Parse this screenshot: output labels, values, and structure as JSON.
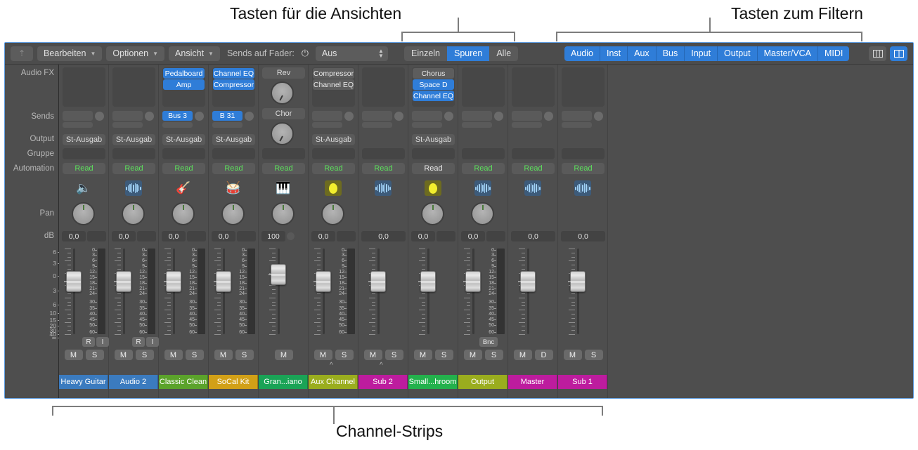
{
  "annotations": {
    "views": "Tasten für die Ansichten",
    "filter": "Tasten zum Filtern",
    "strips": "Channel-Strips"
  },
  "toolbar": {
    "back_icon": "up-arrow-icon",
    "menus": [
      {
        "label": "Bearbeiten",
        "chevron": "⌄"
      },
      {
        "label": "Optionen",
        "chevron": "⌄"
      },
      {
        "label": "Ansicht",
        "chevron": "⌄"
      }
    ],
    "sends_label": "Sends auf Fader:",
    "power_icon": "power-icon",
    "sends_value": "Aus",
    "view_segments": [
      {
        "label": "Einzeln",
        "active": false
      },
      {
        "label": "Spuren",
        "active": true
      },
      {
        "label": "Alle",
        "active": false
      }
    ],
    "filters": [
      {
        "label": "Audio",
        "active": true
      },
      {
        "label": "Inst",
        "active": true
      },
      {
        "label": "Aux",
        "active": true
      },
      {
        "label": "Bus",
        "active": true
      },
      {
        "label": "Input",
        "active": true
      },
      {
        "label": "Output",
        "active": true
      },
      {
        "label": "Master/VCA",
        "active": true
      },
      {
        "label": "MIDI",
        "active": true
      }
    ],
    "view_icons": [
      {
        "name": "three-column-view-icon",
        "active": false
      },
      {
        "name": "two-column-view-icon",
        "active": true
      }
    ]
  },
  "row_labels": {
    "audio_fx": "Audio FX",
    "sends": "Sends",
    "output": "Output",
    "gruppe": "Gruppe",
    "automation": "Automation",
    "pan": "Pan",
    "db": "dB"
  },
  "db_scale": [
    "6",
    "3",
    "0",
    "3",
    "6",
    "10",
    "15",
    "20",
    "30",
    "40",
    "∞"
  ],
  "meter_scale": [
    "0",
    "3",
    "6",
    "9",
    "12",
    "15",
    "18",
    "21",
    "24",
    "30",
    "35",
    "40",
    "45",
    "50",
    "60"
  ],
  "accent_colors": {
    "selected_blue": "#2f7dd8",
    "automation_green": "#5ce05c",
    "panel_gray": "#4e4e4e",
    "toolbar_gray": "#4c4c4c"
  },
  "channels": [
    {
      "name": "Heavy Guitar",
      "color": "#3b7bbf",
      "fx": [],
      "sends": [],
      "send_knob": false,
      "output": "St-Ausgab",
      "gruppe": "",
      "automation": "Read",
      "automation_color": "green",
      "icon": "amp-cabinet-icon",
      "icon_type": "photo",
      "icon_glyph": "🔈",
      "pan": true,
      "db": "0,0",
      "db_type": "main",
      "fader": 0.3,
      "meter": true,
      "ticks": true,
      "record_buttons": [
        "R",
        "I"
      ],
      "bounce": false,
      "ms": [
        "M",
        "S"
      ],
      "caret": false
    },
    {
      "name": "Audio 2",
      "color": "#3b7bbf",
      "fx": [],
      "sends": [],
      "send_knob": false,
      "output": "St-Ausgab",
      "gruppe": "",
      "automation": "Read",
      "automation_color": "green",
      "icon": "waveform-icon",
      "icon_type": "wave",
      "pan": true,
      "db": "0,0",
      "db_type": "main",
      "fader": 0.3,
      "meter": true,
      "ticks": true,
      "record_buttons": [
        "R",
        "I"
      ],
      "bounce": false,
      "ms": [
        "M",
        "S"
      ],
      "caret": false
    },
    {
      "name": "Classic Clean",
      "color": "#5ba32b",
      "fx": [
        {
          "label": "Pedalboard",
          "on": true
        },
        {
          "label": "Amp",
          "on": true
        }
      ],
      "sends": [
        {
          "label": "Bus 3",
          "on": true
        }
      ],
      "send_knob": true,
      "output": "St-Ausgab",
      "gruppe": "",
      "automation": "Read",
      "automation_color": "green",
      "icon": "guitar-icon",
      "icon_type": "photo",
      "icon_glyph": "🎸",
      "pan": true,
      "db": "0,0",
      "db_type": "main",
      "fader": 0.3,
      "meter": true,
      "ticks": true,
      "record_buttons": [],
      "bounce": false,
      "ms": [
        "M",
        "S"
      ],
      "caret": false
    },
    {
      "name": "SoCal Kit",
      "color": "#d2a017",
      "fx": [
        {
          "label": "Channel EQ",
          "on": true
        },
        {
          "label": "Compressor",
          "on": true
        }
      ],
      "sends": [
        {
          "label": "B 31",
          "on": true
        }
      ],
      "send_knob": true,
      "output": "St-Ausgab",
      "gruppe": "",
      "automation": "Read",
      "automation_color": "green",
      "icon": "drum-kit-icon",
      "icon_type": "photo",
      "icon_glyph": "🥁",
      "pan": true,
      "db": "0,0",
      "db_type": "main",
      "fader": 0.3,
      "meter": true,
      "ticks": true,
      "record_buttons": [],
      "bounce": false,
      "ms": [
        "M",
        "S"
      ],
      "caret": false
    },
    {
      "name": "Gran...iano",
      "color": "#1aa356",
      "fx": [],
      "sends": [],
      "send_knob": false,
      "send_knobs_labeled": [
        {
          "label": "Rev"
        },
        {
          "label": "Chor"
        }
      ],
      "output": "",
      "gruppe": "",
      "automation": "Read",
      "automation_color": "green",
      "icon": "piano-icon",
      "icon_type": "photo",
      "icon_glyph": "🎹",
      "pan": true,
      "db": "100",
      "db_type": "aux_knob",
      "fader": 0.22,
      "meter": false,
      "ticks": true,
      "record_buttons": [],
      "bounce": false,
      "ms": [
        "M"
      ],
      "caret": false
    },
    {
      "name": "Aux Channel",
      "color": "#9aad1e",
      "fx": [
        {
          "label": "Compressor",
          "on": false
        },
        {
          "label": "Channel EQ",
          "on": false
        }
      ],
      "sends": [
        {
          "label": "",
          "on": false
        }
      ],
      "send_knob": true,
      "output": "St-Ausgab",
      "gruppe": "",
      "automation": "Read",
      "automation_color": "green",
      "icon": "bus-icon",
      "icon_type": "bus",
      "pan": true,
      "db": "0,0",
      "db_type": "main",
      "fader": 0.3,
      "meter": true,
      "ticks": true,
      "record_buttons": [],
      "bounce": false,
      "ms": [
        "M",
        "S"
      ],
      "caret": true
    },
    {
      "name": "Sub 2",
      "color": "#bd1c9e",
      "fx": [],
      "sends": [],
      "send_knob": false,
      "output": "",
      "gruppe": "",
      "automation": "Read",
      "automation_color": "green",
      "icon": "waveform-icon",
      "icon_type": "wave",
      "pan": false,
      "db": "0,0",
      "db_type": "full",
      "fader": 0.3,
      "meter": false,
      "ticks": true,
      "record_buttons": [],
      "bounce": false,
      "ms": [
        "M",
        "S"
      ],
      "caret": true
    },
    {
      "name": "Small...hroom",
      "color": "#23b14c",
      "fx": [
        {
          "label": "Chorus",
          "on": false
        },
        {
          "label": "Space D",
          "on": true
        },
        {
          "label": "Channel EQ",
          "on": true
        }
      ],
      "sends": [
        {
          "label": "",
          "on": false
        }
      ],
      "send_knob": true,
      "output": "St-Ausgab",
      "gruppe": "",
      "automation": "Read",
      "automation_color": "white",
      "icon": "bus-icon",
      "icon_type": "bus",
      "pan": true,
      "db": "0,0",
      "db_type": "main",
      "fader": 0.3,
      "meter": false,
      "ticks": true,
      "record_buttons": [],
      "bounce": false,
      "ms": [
        "M",
        "S"
      ],
      "caret": false
    },
    {
      "name": "Output",
      "color": "#9aad1e",
      "fx": [],
      "sends": [],
      "send_knob": false,
      "output": "",
      "gruppe": "",
      "automation": "Read",
      "automation_color": "green",
      "icon": "waveform-icon",
      "icon_type": "wave",
      "pan": true,
      "db": "0,0",
      "db_type": "main",
      "fader": 0.3,
      "meter": true,
      "ticks": true,
      "record_buttons": [],
      "bounce": true,
      "bounce_label": "Bnc",
      "ms": [
        "M",
        "S"
      ],
      "caret": false
    },
    {
      "name": "Master",
      "color": "#bd1c9e",
      "fx": [],
      "sends": [],
      "send_knob": false,
      "output": "",
      "gruppe": "",
      "automation": "Read",
      "automation_color": "green",
      "icon": "waveform-icon",
      "icon_type": "wave",
      "pan": false,
      "db": "0,0",
      "db_type": "full",
      "fader": 0.3,
      "meter": false,
      "ticks": true,
      "record_buttons": [],
      "bounce": false,
      "ms": [
        "M",
        "D"
      ],
      "caret": false
    },
    {
      "name": "Sub 1",
      "color": "#bd1c9e",
      "fx": [],
      "sends": [],
      "send_knob": false,
      "output": "",
      "gruppe": "",
      "automation": "Read",
      "automation_color": "green",
      "icon": "waveform-icon",
      "icon_type": "wave",
      "pan": false,
      "db": "0,0",
      "db_type": "full",
      "fader": 0.3,
      "meter": false,
      "ticks": true,
      "record_buttons": [],
      "bounce": false,
      "ms": [
        "M",
        "S"
      ],
      "caret": false
    }
  ]
}
